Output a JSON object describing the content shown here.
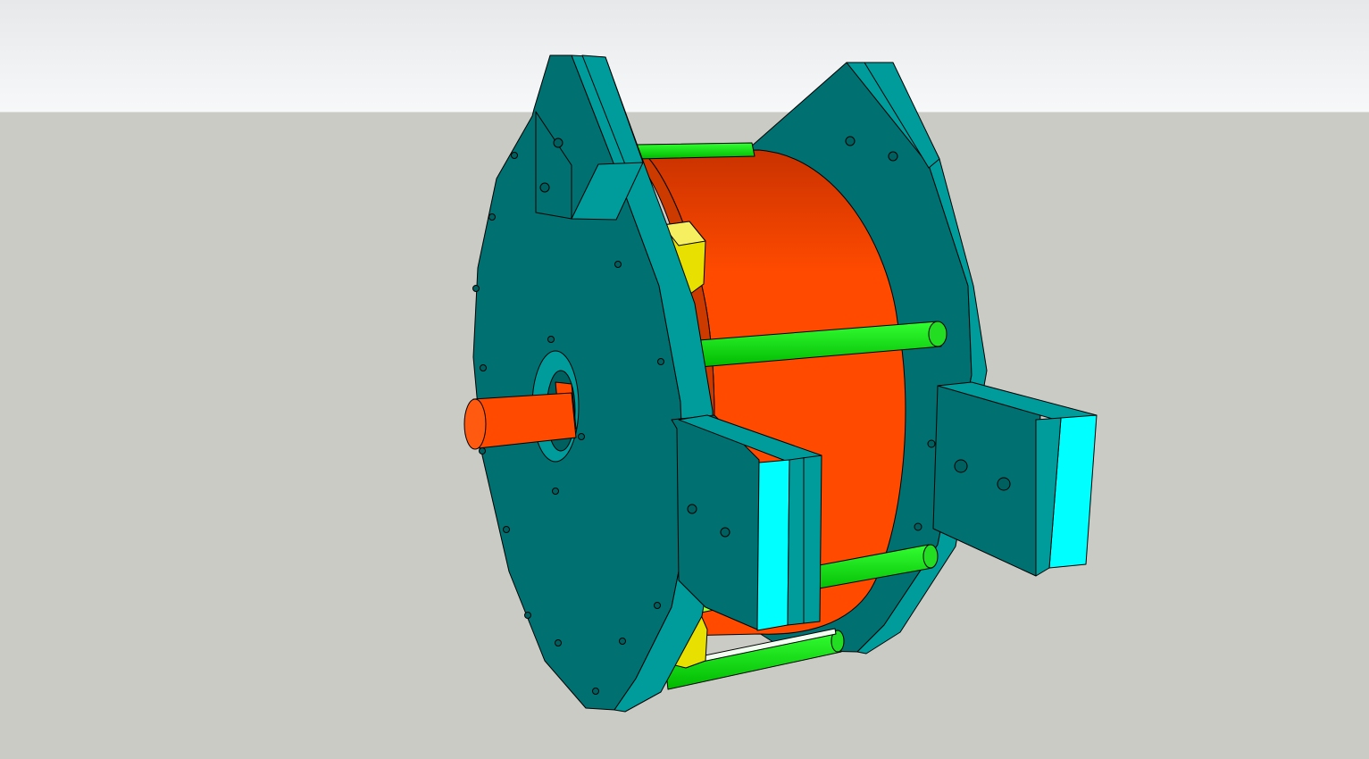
{
  "viewport": {
    "sky_color": "#f5f6f7",
    "ground_color": "#cbcbc6"
  },
  "model": {
    "plate_color": "#007070",
    "plate_edge_color": "#009c9c",
    "clamp_face_color": "#00ffff",
    "rotor_color": "#ff4a00",
    "rotor_shade_color": "#cc3a00",
    "rod_color": "#00e000",
    "magnet_color": "#e8e000",
    "shaft_color": "#ff4a00",
    "outline_color": "#000000"
  }
}
